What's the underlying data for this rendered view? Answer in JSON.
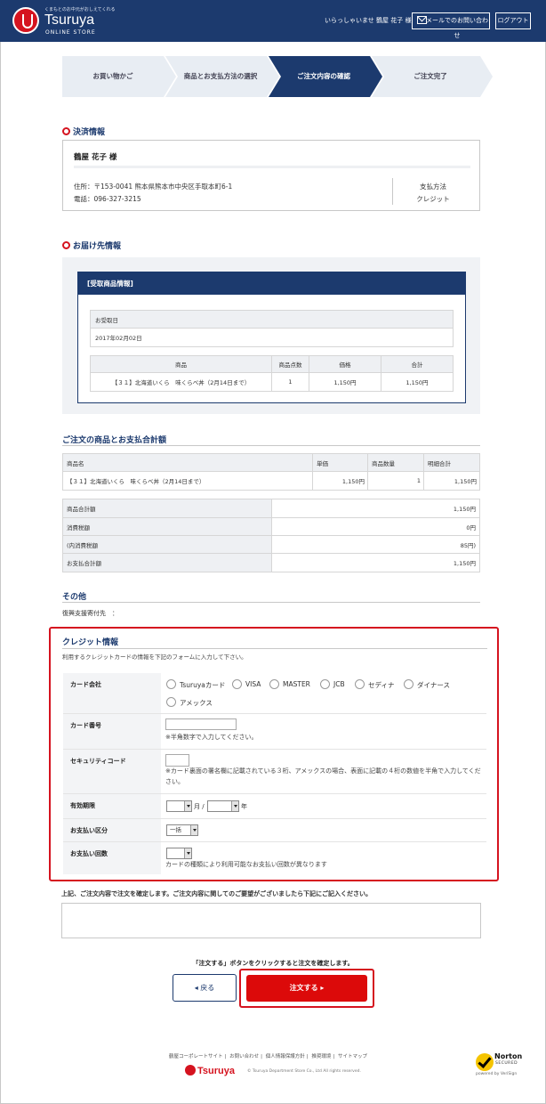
{
  "header": {
    "logo_tagline": "くまもとのお中元がおしえてくれる",
    "logo_name": "Tsuruya",
    "logo_sub": "ONLINE STORE",
    "welcome": "いらっしゃいませ 鶴屋 花子 様",
    "mail_label": "メールでのお問い合わせ",
    "logout_label": "ログアウト"
  },
  "steps": [
    "お買い物かご",
    "商品とお支払方法の選択",
    "ご注文内容の確認",
    "ご注文完了"
  ],
  "payment_section": {
    "title": "決済情報",
    "name": "鶴屋 花子 様",
    "address": "住所：〒153-0041 熊本県熊本市中央区手取本町6-1",
    "phone": "電話：096-327-3215",
    "method_label": "支払方法",
    "method_value": "クレジット"
  },
  "delivery_section": {
    "title": "お届け先情報",
    "box_title": "[受取商品情報]",
    "date_label": "お受取日",
    "date_value": "2017年02月02日",
    "headers": [
      "商品",
      "商品点数",
      "価格",
      "合計"
    ],
    "row": [
      "【３１】北海道いくら　味くらべ丼（2月14日まで）",
      "1",
      "1,150円",
      "1,150円"
    ]
  },
  "order_section": {
    "title": "ご注文の商品とお支払合計額",
    "headers": [
      "商品名",
      "単価",
      "商品数量",
      "明細合計"
    ],
    "row": [
      "【３１】北海道いくら　味くらべ丼（2月14日まで）",
      "1,150円",
      "1",
      "1,150円"
    ],
    "totals": [
      {
        "label": "商品合計額",
        "value": "1,150円"
      },
      {
        "label": "消費税額",
        "value": "0円"
      },
      {
        "label": "(内消費税額",
        "value": "85円)"
      },
      {
        "label": "お支払合計額",
        "value": "1,150円"
      }
    ]
  },
  "other_section": {
    "title": "その他",
    "donation": "復興支援寄付先　："
  },
  "credit": {
    "title": "クレジット情報",
    "desc": "利用するクレジットカードの情報を下記のフォームに入力して下さい。",
    "card_company_label": "カード会社",
    "card_options": [
      "Tsuruyaカード",
      "VISA",
      "MASTER",
      "JCB",
      "セディナ",
      "ダイナース",
      "アメックス"
    ],
    "card_number_label": "カード番号",
    "card_number_note": "※半角数字で入力してください。",
    "security_label": "セキュリティコード",
    "security_note": "※カード裏面の署名欄に記載されている３桁、アメックスの場合、表面に記載の４桁の数値を半角で入力してください。",
    "expiry_label": "有効期限",
    "month_unit": "月 /",
    "year_unit": "年",
    "division_label": "お支払い区分",
    "division_value": "一括",
    "installments_label": "お支払い回数",
    "installments_note": "カードの種類により利用可能なお支払い回数が異なります"
  },
  "confirm_text": "上記、ご注文内容で注文を確定します。ご注文内容に関してのご要望がございましたら下記にご記入ください。",
  "instruction": "「注文する」ボタンをクリックすると注文を確定します。",
  "buttons": {
    "back": "◂ 戻る",
    "order": "注文する ▸"
  },
  "footer": {
    "links": [
      "鶴屋コーポレートサイト",
      "お問い合わせ",
      "個人情報保護方針",
      "推奨環境",
      "サイトマップ"
    ],
    "logo": "Tsuruya",
    "copyright": "© Tsuruya Department Store Co., Ltd All rights reserved.",
    "norton_name": "Norton",
    "norton_secured": "SECURED",
    "norton_powered": "powered by VeriSign"
  },
  "colors": {
    "navy": "#1c3a6e",
    "red": "#d5131f"
  }
}
